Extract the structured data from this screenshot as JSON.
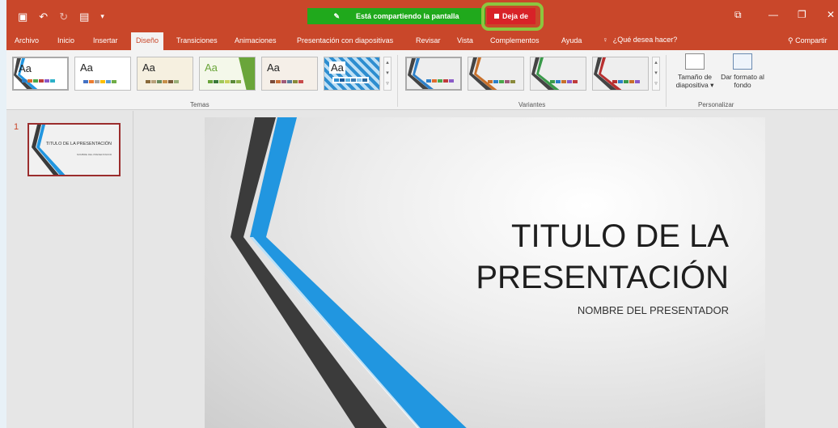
{
  "quick_access": {
    "save_icon": "save-icon",
    "undo_icon": "undo-icon",
    "redo_icon": "redo-icon",
    "present_icon": "present-from-start-icon",
    "more": "▾"
  },
  "share_banner": {
    "text": "Está compartiendo la pantalla",
    "stop_label": "Deja de"
  },
  "window_controls": {
    "ribbon_display": "⧉",
    "minimize": "—",
    "restore": "❐",
    "close": "✕"
  },
  "tabs": [
    {
      "label": "Archivo"
    },
    {
      "label": "Inicio"
    },
    {
      "label": "Insertar"
    },
    {
      "label": "Diseño"
    },
    {
      "label": "Transiciones"
    },
    {
      "label": "Animaciones"
    },
    {
      "label": "Presentación con diapositivas"
    },
    {
      "label": "Revisar"
    },
    {
      "label": "Vista"
    },
    {
      "label": "Complementos"
    },
    {
      "label": "Ayuda"
    }
  ],
  "tellme": {
    "icon": "lightbulb-icon",
    "text": "¿Qué desea hacer?"
  },
  "share_button": {
    "icon": "person-icon",
    "label": "Compartir"
  },
  "ribbon": {
    "themes": {
      "group_label": "Temas",
      "items": [
        {
          "label": "Aa",
          "accent": "#3a7abf"
        },
        {
          "label": "Aa",
          "accent": "#555555"
        },
        {
          "label": "Aa",
          "accent": "#b8a07a"
        },
        {
          "label": "Aa",
          "accent": "#6aa53a"
        },
        {
          "label": "Aa",
          "accent": "#7a4a3a"
        },
        {
          "label": "Aa",
          "accent": "#2e8ed0"
        }
      ]
    },
    "variants": {
      "group_label": "Variantes",
      "items": [
        {
          "accent": "#2c7fc8"
        },
        {
          "accent": "#c8702a"
        },
        {
          "accent": "#3a9a4a"
        },
        {
          "accent": "#b83030"
        }
      ]
    },
    "customize": {
      "group_label": "Personalizar",
      "slide_size": "Tamaño de diapositiva",
      "slide_size_arrow": "▾",
      "format_bg": "Dar formato al fondo"
    }
  },
  "slide_panel": {
    "number": "1",
    "thumb_title": "TITULO DE LA PRESENTACIÓN",
    "thumb_subtitle": "NOMBRE DEL PRESENTADOR"
  },
  "slide": {
    "title_line1": "TITULO DE LA",
    "title_line2": "PRESENTACIÓN",
    "subtitle": "NOMBRE DEL PRESENTADOR"
  },
  "colors": {
    "accent": "#c9472a",
    "share_green": "#20a91c",
    "stop_red": "#d82228",
    "highlight": "#8cc63f",
    "stripe_blue": "#2196e0",
    "stripe_dark": "#3b3b3b"
  }
}
